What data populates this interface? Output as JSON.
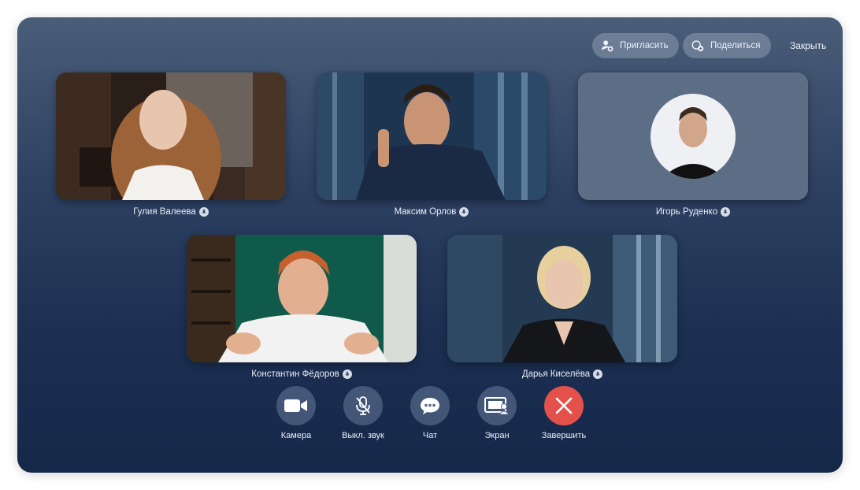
{
  "header": {
    "invite_label": "Пригласить",
    "share_label": "Поделиться",
    "close_label": "Закрыть"
  },
  "participants": [
    {
      "name": "Гулия Валеева"
    },
    {
      "name": "Максим Орлов"
    },
    {
      "name": "Игорь Руденко"
    },
    {
      "name": "Константин Фёдоров"
    },
    {
      "name": "Дарья Киселёва"
    }
  ],
  "controls": [
    {
      "label": "Камера",
      "icon": "camera-icon"
    },
    {
      "label": "Выкл. звук",
      "icon": "mic-off-icon"
    },
    {
      "label": "Чат",
      "icon": "chat-icon"
    },
    {
      "label": "Экран",
      "icon": "screen-share-icon"
    },
    {
      "label": "Завершить",
      "icon": "end-call-icon"
    }
  ],
  "colors": {
    "end_call": "#e4514a",
    "background_top": "#4a5d78",
    "background_bottom": "#15284a"
  }
}
